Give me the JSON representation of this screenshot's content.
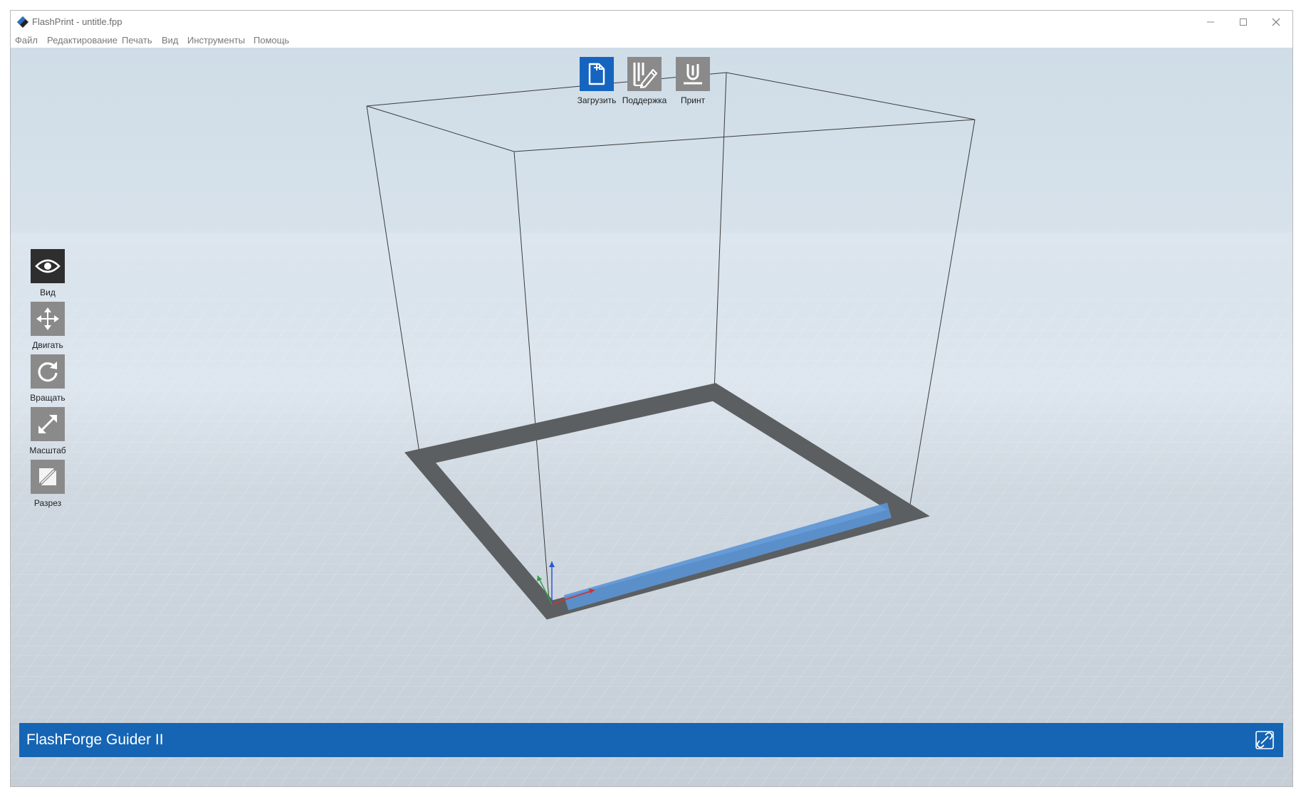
{
  "window": {
    "title": "FlashPrint - untitle.fpp"
  },
  "menu": [
    "Файл",
    "Редактирование",
    "Печать",
    "Вид",
    "Инструменты",
    "Помощь"
  ],
  "top_toolbar": [
    {
      "label": "Загрузить",
      "icon": "load-file-icon",
      "active": true
    },
    {
      "label": "Поддержка",
      "icon": "supports-icon",
      "active": false
    },
    {
      "label": "Принт",
      "icon": "print-icon",
      "active": false
    }
  ],
  "side_toolbar": [
    {
      "label": "Вид",
      "icon": "eye-icon",
      "active": true
    },
    {
      "label": "Двигать",
      "icon": "move-icon",
      "active": false
    },
    {
      "label": "Вращать",
      "icon": "rotate-icon",
      "active": false
    },
    {
      "label": "Масштаб",
      "icon": "scale-icon",
      "active": false
    },
    {
      "label": "Разрез",
      "icon": "cut-icon",
      "active": false
    }
  ],
  "status": {
    "printer": "FlashForge Guider II",
    "icon": "connect-icon"
  },
  "colors": {
    "accent": "#1565b4",
    "tool_active_blue": "#1565c0",
    "tool_active_dark": "#2e2e2e",
    "tool_inactive": "#8a8a8a",
    "bed_border": "#5c5f61",
    "bed_front_highlight": "#5b95d6"
  }
}
